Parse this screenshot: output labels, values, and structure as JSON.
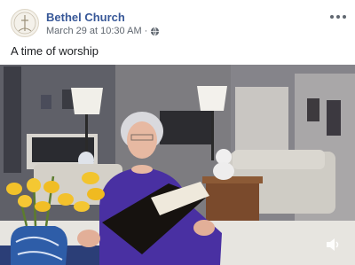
{
  "post": {
    "page_name": "Bethel Church",
    "timestamp": "March 29 at 10:30 AM",
    "separator": "·",
    "privacy_icon": "globe-icon",
    "more_icon": "more-options-icon",
    "caption": "A time of worship"
  },
  "video": {
    "scene": "woman-reading-bible-in-living-room",
    "mute_icon": "volume-icon"
  },
  "colors": {
    "link": "#385898",
    "text": "#1c1e21",
    "meta": "#606770"
  }
}
